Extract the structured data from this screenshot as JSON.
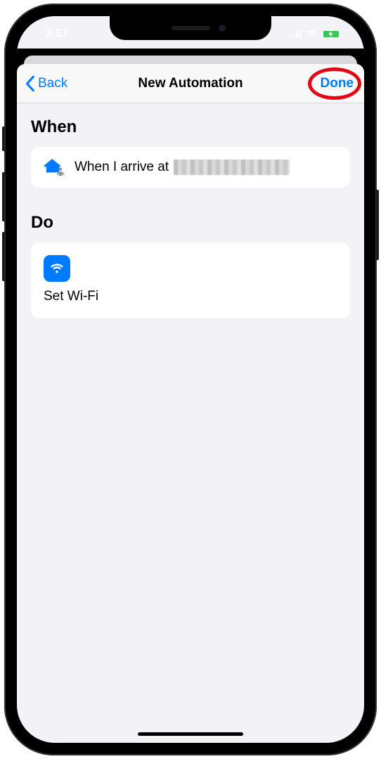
{
  "status": {
    "time": "3:57"
  },
  "nav": {
    "back_label": "Back",
    "title": "New Automation",
    "done_label": "Done"
  },
  "sections": {
    "when_header": "When",
    "do_header": "Do"
  },
  "when": {
    "text": "When I arrive at"
  },
  "do": {
    "action_label": "Set Wi-Fi"
  },
  "colors": {
    "ios_blue": "#007aff",
    "highlight_red": "#e30613",
    "battery_green": "#34c759"
  }
}
